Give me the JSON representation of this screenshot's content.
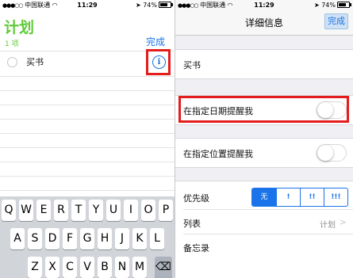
{
  "left": {
    "status": {
      "carrier": "中国联通",
      "time": "11:29",
      "battery": "74%"
    },
    "list_title": "计划",
    "item_count": "1 项",
    "done_label": "完成",
    "task": {
      "text": "买书"
    },
    "info_icon_glyph": "i",
    "keyboard": {
      "row1": [
        "Q",
        "W",
        "E",
        "R",
        "T",
        "Y",
        "U",
        "I",
        "O",
        "P"
      ],
      "row2": [
        "A",
        "S",
        "D",
        "F",
        "G",
        "H",
        "J",
        "K",
        "L"
      ],
      "row3": [
        "Z",
        "X",
        "C",
        "V",
        "B",
        "N",
        "M"
      ]
    }
  },
  "right": {
    "status": {
      "carrier": "中国联通",
      "time": "11:29",
      "battery": "74%"
    },
    "nav_title": "详细信息",
    "done_label": "完成",
    "task_title": "买书",
    "remind_date_label": "在指定日期提醒我",
    "remind_location_label": "在指定位置提醒我",
    "remind_date_on": false,
    "remind_location_on": false,
    "priority_label": "优先级",
    "priority_options": [
      "无",
      "!",
      "!!",
      "!!!"
    ],
    "priority_selected": "无",
    "list_label": "列表",
    "list_value": "计划",
    "notes_label": "备忘录"
  },
  "colors": {
    "accent": "#1a73e8",
    "list_green": "#5fca3a",
    "highlight_red": "#e41c1c"
  }
}
